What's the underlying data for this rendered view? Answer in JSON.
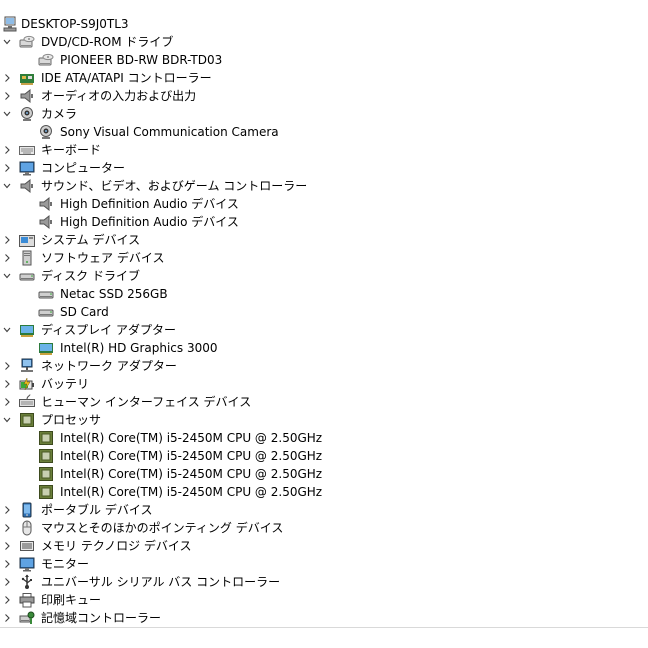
{
  "root": "DESKTOP-S9J0TL3",
  "rows": [
    {
      "d": 1,
      "e": true,
      "i": "dvd-drive-icon",
      "t": "DVD/CD-ROM ドライブ"
    },
    {
      "d": 2,
      "i": "dvd-drive-icon",
      "t": "PIONEER BD-RW   BDR-TD03"
    },
    {
      "d": 1,
      "e": false,
      "i": "ide-controller-icon",
      "t": "IDE ATA/ATAPI コントローラー"
    },
    {
      "d": 1,
      "e": false,
      "i": "speaker-icon",
      "t": "オーディオの入力および出力"
    },
    {
      "d": 1,
      "e": true,
      "i": "camera-icon",
      "t": "カメラ"
    },
    {
      "d": 2,
      "i": "camera-icon",
      "t": "Sony Visual Communication Camera"
    },
    {
      "d": 1,
      "e": false,
      "i": "keyboard-icon",
      "t": "キーボード"
    },
    {
      "d": 1,
      "e": false,
      "i": "monitor-icon",
      "t": "コンピューター"
    },
    {
      "d": 1,
      "e": true,
      "i": "speaker-icon",
      "t": "サウンド、ビデオ、およびゲーム コントローラー"
    },
    {
      "d": 2,
      "i": "speaker-icon",
      "t": "High Definition Audio デバイス"
    },
    {
      "d": 2,
      "i": "speaker-icon",
      "t": "High Definition Audio デバイス"
    },
    {
      "d": 1,
      "e": false,
      "i": "system-device-icon",
      "t": "システム デバイス"
    },
    {
      "d": 1,
      "e": false,
      "i": "software-device-icon",
      "t": "ソフトウェア デバイス"
    },
    {
      "d": 1,
      "e": true,
      "i": "disk-drive-icon",
      "t": "ディスク ドライブ"
    },
    {
      "d": 2,
      "i": "disk-drive-icon",
      "t": "Netac SSD 256GB"
    },
    {
      "d": 2,
      "i": "disk-drive-icon",
      "t": "SD Card"
    },
    {
      "d": 1,
      "e": true,
      "i": "display-adapter-icon",
      "t": "ディスプレイ アダプター"
    },
    {
      "d": 2,
      "i": "display-adapter-icon",
      "t": "Intel(R) HD Graphics 3000"
    },
    {
      "d": 1,
      "e": false,
      "i": "network-icon",
      "t": "ネットワーク アダプター"
    },
    {
      "d": 1,
      "e": false,
      "i": "battery-icon",
      "t": "バッテリ"
    },
    {
      "d": 1,
      "e": false,
      "i": "hid-icon",
      "t": "ヒューマン インターフェイス デバイス"
    },
    {
      "d": 1,
      "e": true,
      "i": "processor-icon",
      "t": "プロセッサ"
    },
    {
      "d": 2,
      "i": "processor-icon",
      "t": "Intel(R) Core(TM) i5-2450M CPU @ 2.50GHz"
    },
    {
      "d": 2,
      "i": "processor-icon",
      "t": "Intel(R) Core(TM) i5-2450M CPU @ 2.50GHz"
    },
    {
      "d": 2,
      "i": "processor-icon",
      "t": "Intel(R) Core(TM) i5-2450M CPU @ 2.50GHz"
    },
    {
      "d": 2,
      "i": "processor-icon",
      "t": "Intel(R) Core(TM) i5-2450M CPU @ 2.50GHz"
    },
    {
      "d": 1,
      "e": false,
      "i": "portable-device-icon",
      "t": "ポータブル デバイス"
    },
    {
      "d": 1,
      "e": false,
      "i": "mouse-icon",
      "t": "マウスとそのほかのポインティング デバイス"
    },
    {
      "d": 1,
      "e": false,
      "i": "memory-tech-icon",
      "t": "メモリ テクノロジ デバイス"
    },
    {
      "d": 1,
      "e": false,
      "i": "monitor-icon",
      "t": "モニター"
    },
    {
      "d": 1,
      "e": false,
      "i": "usb-icon",
      "t": "ユニバーサル シリアル バス コントローラー"
    },
    {
      "d": 1,
      "e": false,
      "i": "printer-icon",
      "t": "印刷キュー"
    },
    {
      "d": 1,
      "e": false,
      "i": "storage-controller-icon",
      "t": "記憶域コントローラー"
    }
  ]
}
